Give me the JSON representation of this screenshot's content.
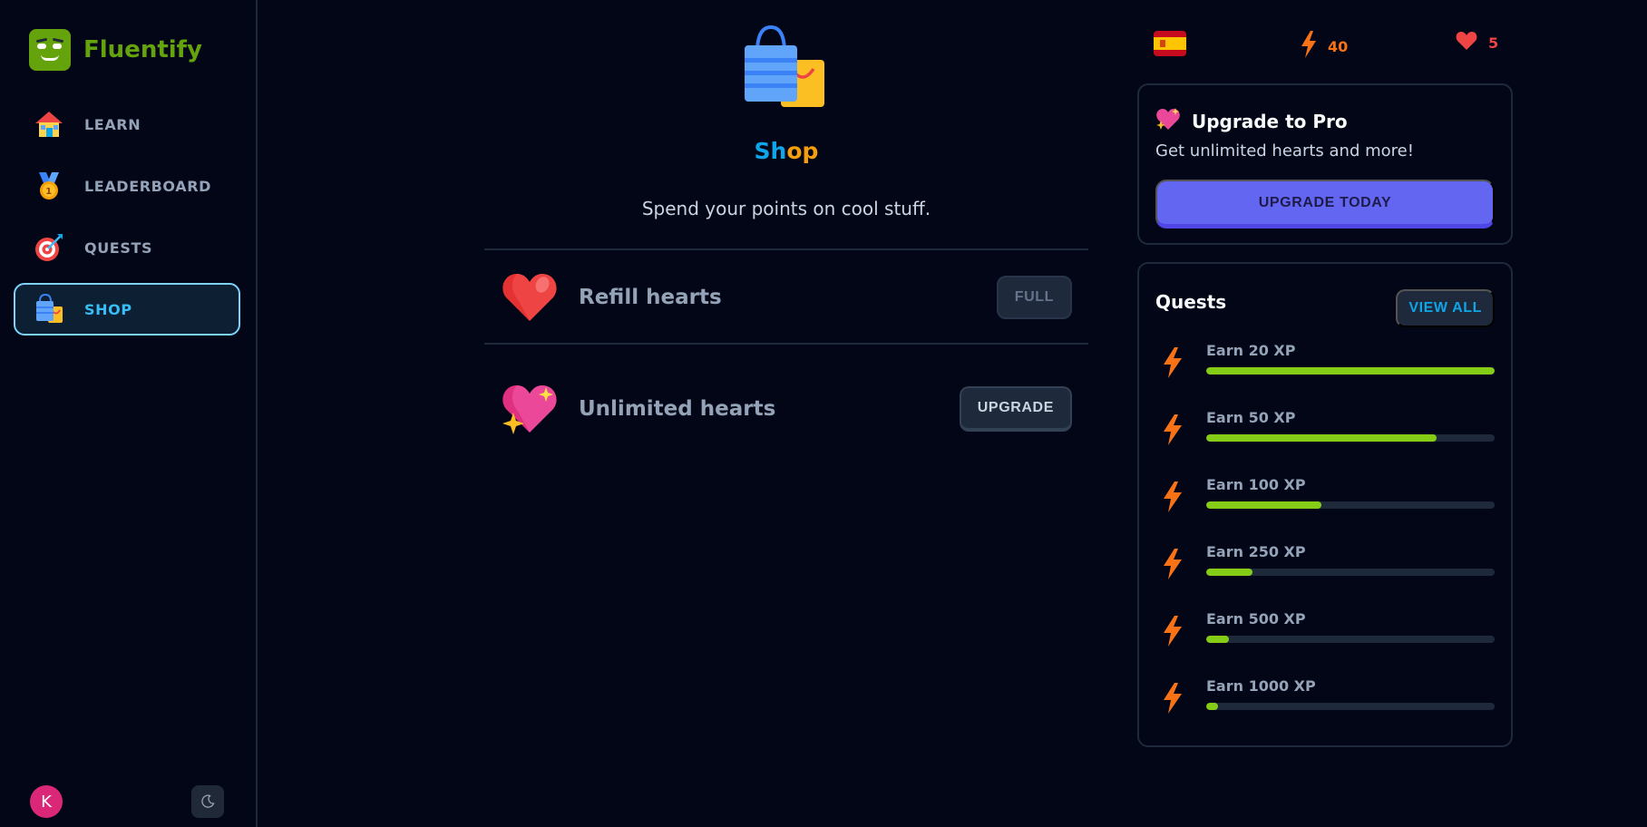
{
  "app": {
    "name": "Fluentify"
  },
  "sidebar": {
    "items": [
      {
        "label": "LEARN",
        "icon": "house-icon",
        "active": false
      },
      {
        "label": "LEADERBOARD",
        "icon": "medal-icon",
        "active": false
      },
      {
        "label": "QUESTS",
        "icon": "target-icon",
        "active": false
      },
      {
        "label": "SHOP",
        "icon": "shopping-bags-icon",
        "active": true
      }
    ],
    "avatar_initial": "K"
  },
  "stats": {
    "language_flag": "spain-flag-icon",
    "points": "40",
    "hearts": "5"
  },
  "shop": {
    "title_part1": "Sh",
    "title_part2": "op",
    "subtitle": "Spend your points on cool stuff.",
    "items": [
      {
        "label": "Refill hearts",
        "button": "FULL",
        "icon": "heart-icon"
      },
      {
        "label": "Unlimited hearts",
        "button": "UPGRADE",
        "icon": "sparkling-heart-icon"
      }
    ]
  },
  "pro": {
    "title": "Upgrade to Pro",
    "subtitle": "Get unlimited hearts and more!",
    "button": "UPGRADE TODAY"
  },
  "quests": {
    "title": "Quests",
    "view_all": "VIEW ALL",
    "items": [
      {
        "label": "Earn 20 XP",
        "progress": 1.0
      },
      {
        "label": "Earn 50 XP",
        "progress": 0.8
      },
      {
        "label": "Earn 100 XP",
        "progress": 0.4
      },
      {
        "label": "Earn 250 XP",
        "progress": 0.16
      },
      {
        "label": "Earn 500 XP",
        "progress": 0.08
      },
      {
        "label": "Earn 1000 XP",
        "progress": 0.04
      }
    ]
  },
  "colors": {
    "brand": "#65a30d",
    "accent": "#0ea5e9",
    "progress": "#84cc16",
    "pro": "#6366f1",
    "points": "#f97316",
    "hearts": "#ef4444"
  }
}
